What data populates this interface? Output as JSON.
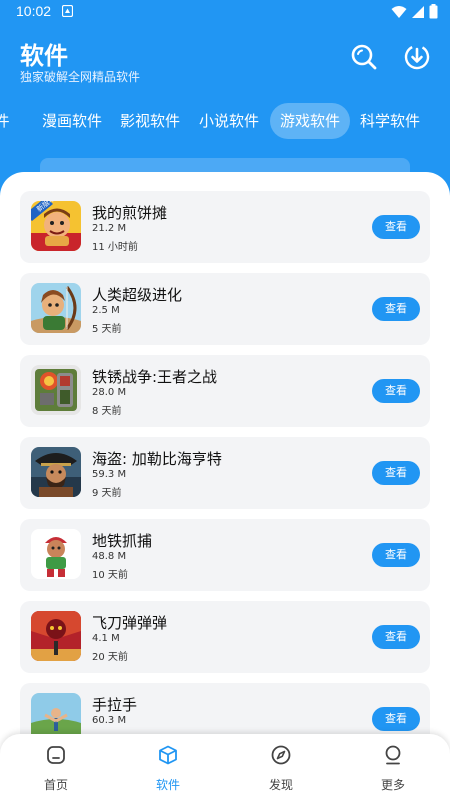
{
  "status": {
    "time": "10:02"
  },
  "header": {
    "title": "软件",
    "subtitle": "独家破解全网精品软件",
    "search_icon": "search-icon",
    "download_icon": "download-icon"
  },
  "tabs": [
    {
      "label": "件"
    },
    {
      "label": "漫画软件"
    },
    {
      "label": "影视软件"
    },
    {
      "label": "小说软件"
    },
    {
      "label": "游戏软件",
      "active": true
    },
    {
      "label": "科学软件"
    }
  ],
  "apps": [
    {
      "name": "我的煎饼摊",
      "size": "21.2 M",
      "time": "11 小时前",
      "action": "查看",
      "badge": "新版本",
      "icon": "pancake-stall-game-icon"
    },
    {
      "name": "人类超级进化",
      "size": "2.5 M",
      "time": "5 天前",
      "action": "查看",
      "icon": "archer-warrior-game-icon"
    },
    {
      "name": "铁锈战争:王者之战",
      "size": "28.0 M",
      "time": "8 天前",
      "action": "查看",
      "icon": "rusted-warfare-game-icon"
    },
    {
      "name": "海盗: 加勒比海亨特",
      "size": "59.3 M",
      "time": "9 天前",
      "action": "查看",
      "icon": "pirate-captain-game-icon"
    },
    {
      "name": "地铁抓捕",
      "size": "48.8 M",
      "time": "10 天前",
      "action": "查看",
      "icon": "subway-runner-game-icon"
    },
    {
      "name": "飞刀弹弹弹",
      "size": "4.1 M",
      "time": "20 天前",
      "action": "查看",
      "icon": "flying-knife-game-icon"
    },
    {
      "name": "手拉手",
      "size": "60.3 M",
      "time": "",
      "action": "查看",
      "icon": "hand-in-hand-game-icon"
    }
  ],
  "nav": [
    {
      "label": "首页",
      "icon": "home-icon"
    },
    {
      "label": "软件",
      "icon": "cube-icon",
      "active": true
    },
    {
      "label": "发现",
      "icon": "compass-icon"
    },
    {
      "label": "更多",
      "icon": "profile-icon"
    }
  ],
  "colors": {
    "primary": "#2196f3",
    "card_bg": "#f3f4f6"
  }
}
